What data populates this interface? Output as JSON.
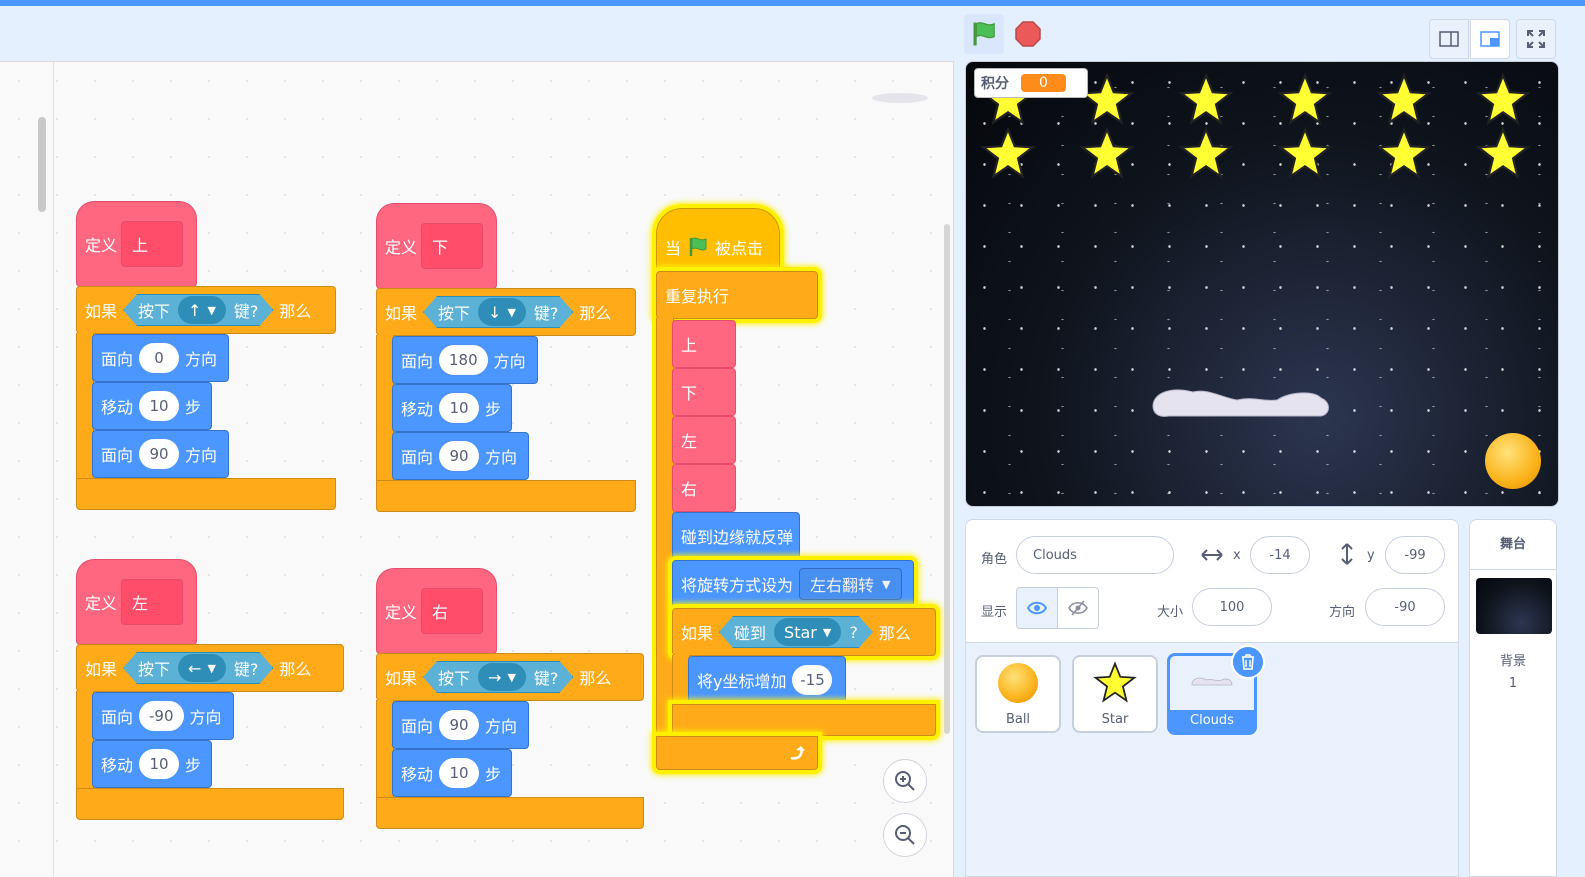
{
  "toolbar": {
    "green_flag": "green-flag",
    "stop": "stop-sign",
    "layout_small": "small-stage",
    "layout_normal": "normal-stage",
    "fullscreen": "fullscreen"
  },
  "scripts": {
    "define": "定义",
    "if": "如果",
    "then": "那么",
    "key_pressed": "按下",
    "key_q": "键?",
    "point_in": "面向",
    "direction": "方向",
    "move": "移动",
    "steps": "步",
    "up": {
      "name": "上",
      "key": "↑",
      "dir1": "0",
      "steps": "10",
      "dir2": "90"
    },
    "down": {
      "name": "下",
      "key": "↓",
      "dir1": "180",
      "steps": "10",
      "dir2": "90"
    },
    "left": {
      "name": "左",
      "key": "←",
      "dir1": "-90",
      "steps": "10"
    },
    "right": {
      "name": "右",
      "key": "→",
      "dir1": "90",
      "steps": "10"
    },
    "main": {
      "when": "当",
      "clicked": "被点击",
      "forever": "重复执行",
      "calls": [
        "上",
        "下",
        "左",
        "右"
      ],
      "bounce": "碰到边缘就反弹",
      "rot_set": "将旋转方式设为",
      "rot_val": "左右翻转",
      "if": "如果",
      "touching": "碰到",
      "target": "Star",
      "q": "?",
      "then": "那么",
      "change_y": "将y坐标增加",
      "change_val": "-15"
    }
  },
  "stage": {
    "score_label": "积分",
    "score_value": "0",
    "stars": 12
  },
  "sprite_info": {
    "sprite_label": "角色",
    "sprite_name": "Clouds",
    "x_label": "x",
    "x": "-14",
    "y_label": "y",
    "y": "-99",
    "show_label": "显示",
    "size_label": "大小",
    "size": "100",
    "dir_label": "方向",
    "dir": "-90"
  },
  "sprites": [
    {
      "name": "Ball"
    },
    {
      "name": "Star"
    },
    {
      "name": "Clouds",
      "selected": true
    }
  ],
  "backdrop": {
    "title": "舞台",
    "label": "背景",
    "count": "1"
  },
  "colors": {
    "motion": "#4c97ff",
    "control": "#ffab19",
    "myblocks": "#ff6680",
    "events": "#ffbf00",
    "sensing": "#5cb1d6",
    "glow": "#fff000"
  }
}
